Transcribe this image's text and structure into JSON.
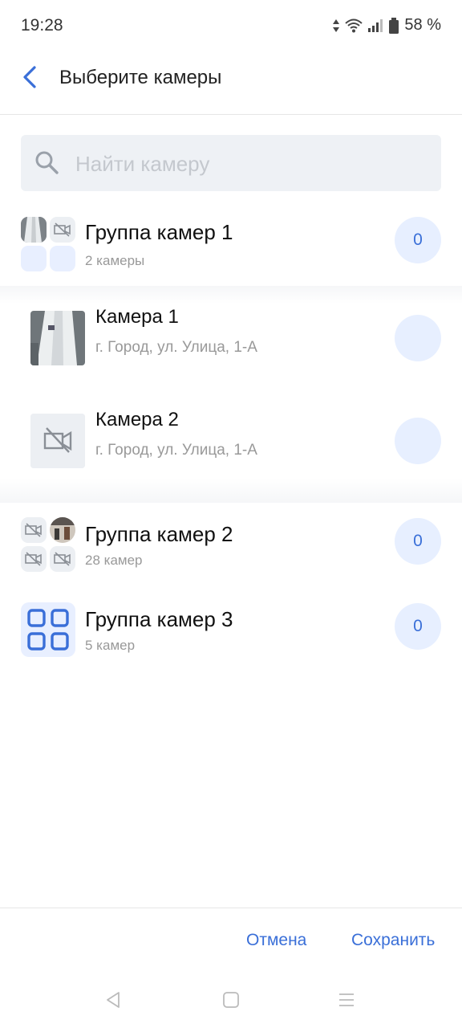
{
  "status": {
    "time": "19:28",
    "battery": "58 %"
  },
  "header": {
    "title": "Выберите камеры",
    "back_icon": "chevron-left-icon"
  },
  "search": {
    "placeholder": "Найти камеру",
    "value": ""
  },
  "groups": [
    {
      "name": "Группа камер 1",
      "count_label": "2 камеры",
      "selected": "0"
    },
    {
      "name": "Группа камер 2",
      "count_label": "28 камер",
      "selected": "0"
    },
    {
      "name": "Группа камер 3",
      "count_label": "5 камер",
      "selected": "0"
    }
  ],
  "cameras": [
    {
      "name": "Камера 1",
      "address": "г. Город, ул. Улица, 1-А"
    },
    {
      "name": "Камера 2",
      "address": "г. Город, ул. Улица, 1-А"
    }
  ],
  "footer": {
    "cancel": "Отмена",
    "save": "Сохранить"
  },
  "colors": {
    "accent": "#3a6fd8",
    "badge_bg": "#e7efff",
    "search_bg": "#eef1f5"
  }
}
